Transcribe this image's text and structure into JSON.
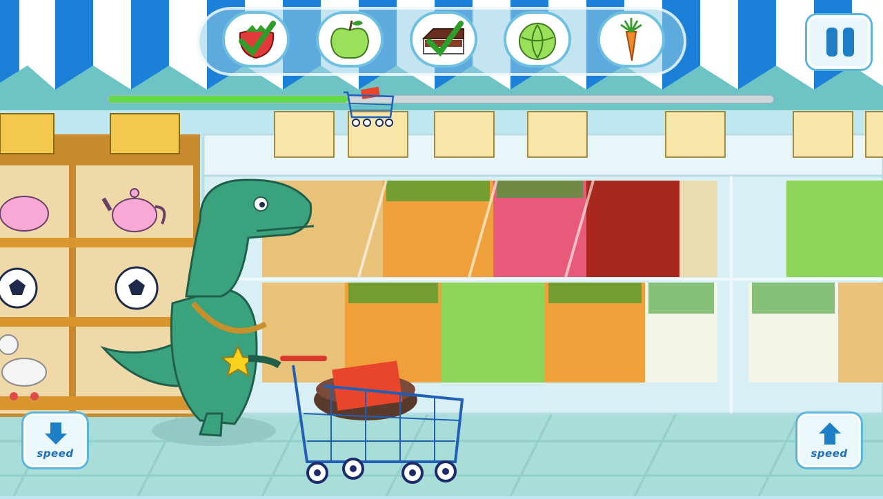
{
  "hud": {
    "shopping_list": [
      {
        "item": "strawberry",
        "icon": "strawberry-icon",
        "collected": true
      },
      {
        "item": "apple",
        "icon": "green-apple-icon",
        "collected": false
      },
      {
        "item": "cake",
        "icon": "cake-icon",
        "collected": true
      },
      {
        "item": "cabbage",
        "icon": "cabbage-icon",
        "collected": false
      },
      {
        "item": "carrot",
        "icon": "carrot-icon",
        "collected": false
      }
    ],
    "progress_fraction": 0.36
  },
  "controls": {
    "slow_down_label": "speed",
    "speed_up_label": "speed"
  },
  "colors": {
    "accent_blue": "#1f7fc6",
    "progress_green": "#62d94a",
    "check_green": "#2e9e2a",
    "dino_green": "#3aa37e"
  }
}
